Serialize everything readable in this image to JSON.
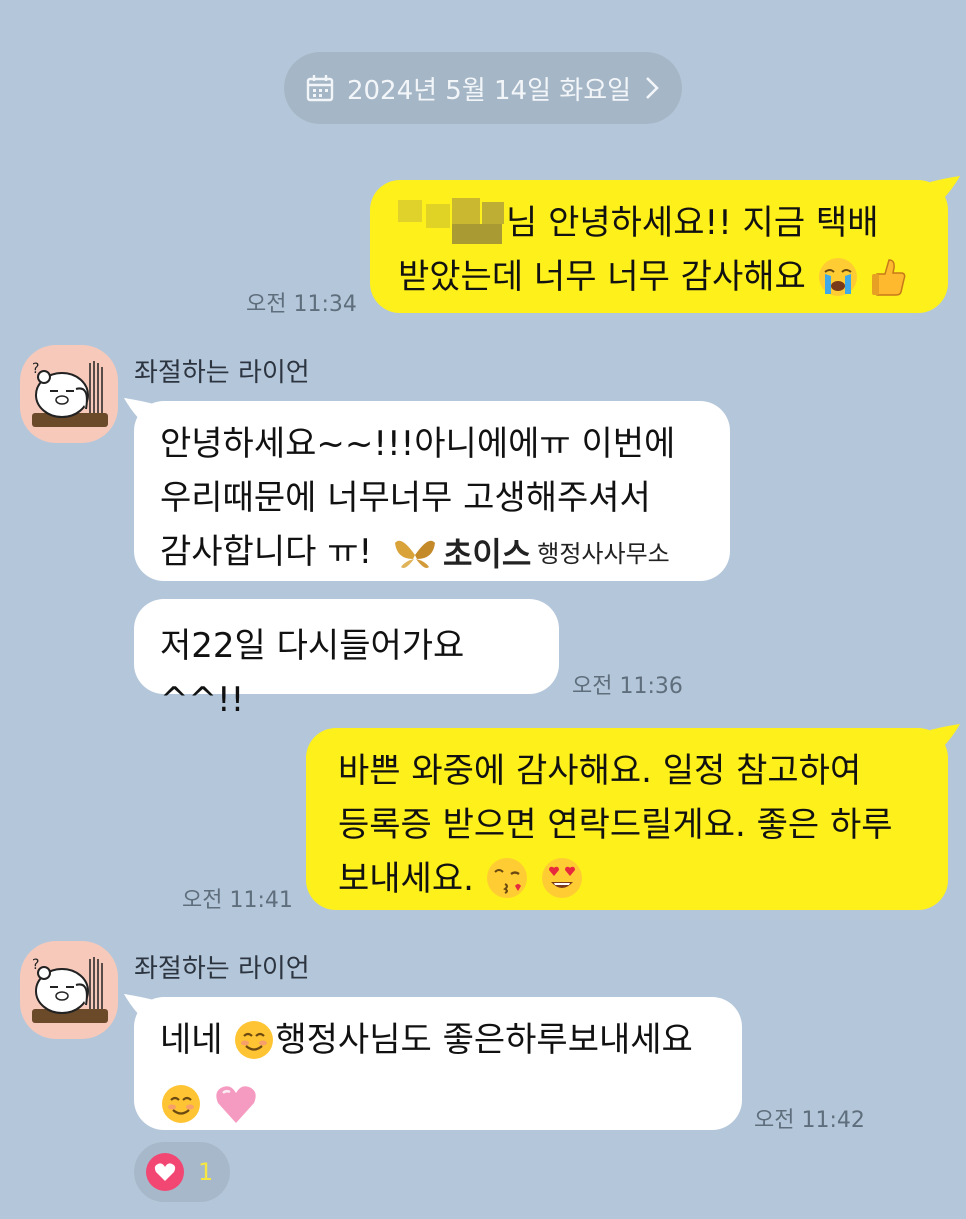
{
  "date_divider": {
    "label": "2024년 5월 14일 화요일",
    "icon": "calendar-icon",
    "chevron": "chevron-right-icon"
  },
  "colors": {
    "background": "#b4c7da",
    "my_bubble": "#fef01b",
    "their_bubble": "#ffffff",
    "avatar_bg": "#f6c9bb",
    "heart": "#f24773"
  },
  "messages": [
    {
      "from": "me",
      "line1": "님 안녕하세요!! 지금 택배",
      "line2": "받았는데 너무 너무 감사해요",
      "emojis": [
        "crying-emoji",
        "thumbs-up-emoji"
      ],
      "time": "오전 11:34"
    },
    {
      "from": "them",
      "sender": "좌절하는 라이언",
      "line1": "안녕하세요~~!!!아니에에ㅠ 이번에",
      "line2": "우리때문에 너무너무 고생해주셔서",
      "line3": "감사합니다 ㅠ!",
      "brand_name": "초이스",
      "brand_sub": "행정사사무소"
    },
    {
      "from": "them",
      "line1": "저22일 다시들어가요^^!!",
      "time": "오전 11:36"
    },
    {
      "from": "me",
      "line1": "바쁜 와중에 감사해요. 일정 참고하여",
      "line2": "등록증 받으면 연락드릴게요. 좋은 하루",
      "line3": "보내세요.",
      "emojis": [
        "kiss-emoji",
        "heart-eyes-emoji"
      ],
      "time": "오전 11:41"
    },
    {
      "from": "them",
      "sender": "좌절하는 라이언",
      "line1a": "네네",
      "line1b": "행정사님도 좋은하루보내세요",
      "emojis": [
        "smiling-emoji",
        "smiling-emoji",
        "pink-heart-emoji"
      ],
      "time": "오전 11:42"
    }
  ],
  "reaction": {
    "icon": "heart-icon",
    "count": "1"
  }
}
